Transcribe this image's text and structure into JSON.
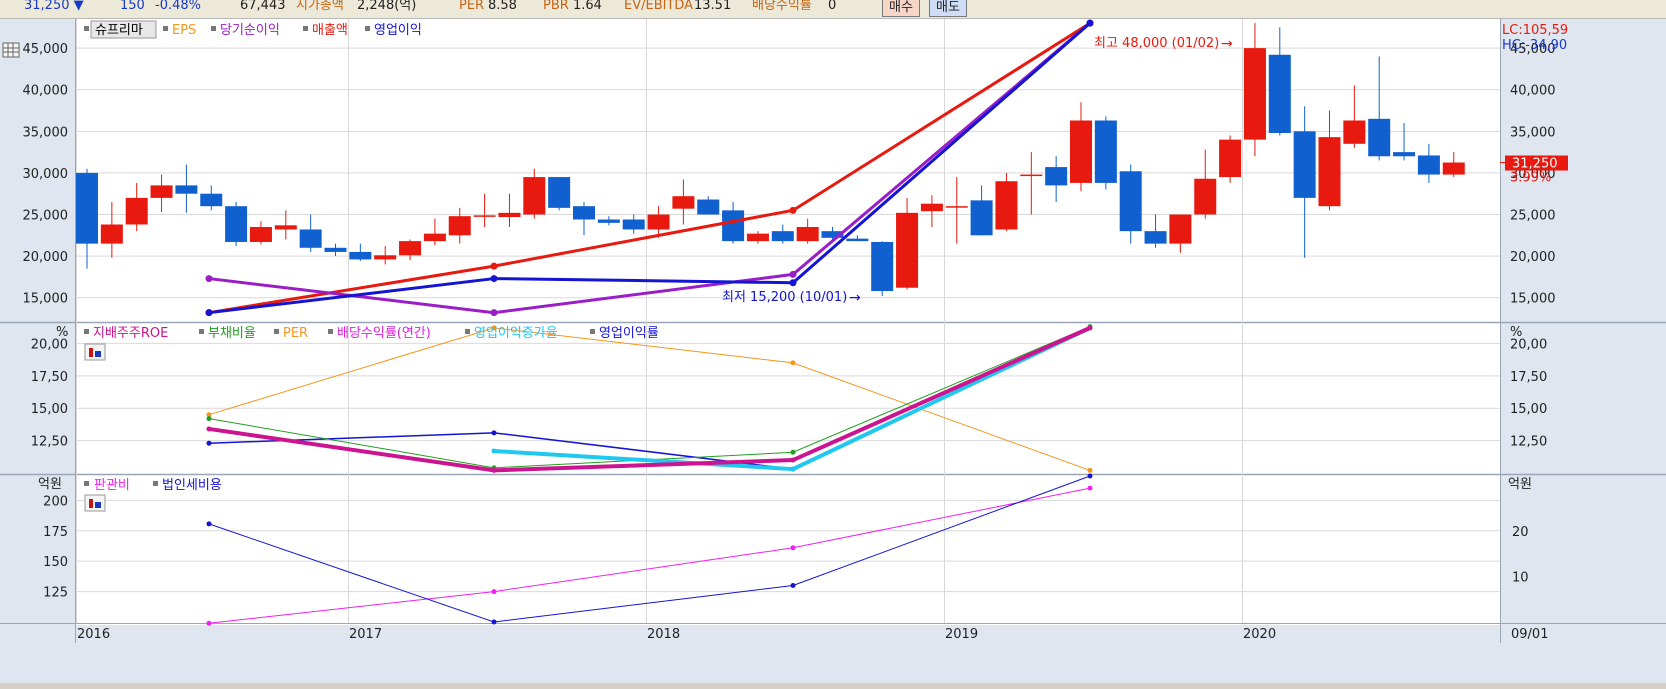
{
  "infobar": {
    "price": "31,250",
    "change": "150",
    "change_pct": "-0.48%",
    "volume": "67,443",
    "mktcap_label": "시가총액",
    "mktcap_value": "2,248(억)",
    "per_label": "PER",
    "per_value": "8.58",
    "pbr_label": "PBR",
    "pbr_value": "1.64",
    "ev_label": "EV/EBITDA",
    "ev_value": "13.51",
    "div_label": "배당수익률",
    "div_value": "0",
    "buy_label": "매수",
    "sell_label": "매도"
  },
  "colors": {
    "up": "#e8190e",
    "down": "#1160d0",
    "eps": "#f4961e",
    "netincome": "#9a1ec8",
    "sales": "#e8190e",
    "op_income": "#1414d2",
    "roe": "#cc1490",
    "debt": "#20a020",
    "per": "#f4961e",
    "div_yield": "#e020e0",
    "op_growth": "#20c8f0",
    "op_margin": "#1414d2",
    "sga": "#f020f0",
    "tax": "#1414d2"
  },
  "chart_data": [
    {
      "type": "candlestick",
      "title": "",
      "legend": [
        "슈프리마",
        "EPS",
        "당기순이익",
        "매출액",
        "영업이익"
      ],
      "x_labels": [
        "2016",
        "2017",
        "2018",
        "2019",
        "2020"
      ],
      "y_ticks": [
        15000,
        20000,
        25000,
        30000,
        35000,
        40000,
        45000
      ],
      "y_tick_labels": [
        "15,000",
        "20,000",
        "25,000",
        "30,000",
        "35,000",
        "40,000",
        "45,000"
      ],
      "ylim": [
        12200,
        48500
      ],
      "right_labels": {
        "lc": "LC:105,59",
        "hc": "HC:-34,90",
        "price": "31,250",
        "pct": "3.99%"
      },
      "last_price": 31250,
      "grid": true,
      "candles": [
        {
          "o": 30000,
          "h": 30500,
          "l": 18500,
          "c": 21500
        },
        {
          "o": 21500,
          "h": 26500,
          "l": 19800,
          "c": 23800
        },
        {
          "o": 23800,
          "h": 28800,
          "l": 23000,
          "c": 27000
        },
        {
          "o": 27000,
          "h": 29800,
          "l": 25300,
          "c": 28500
        },
        {
          "o": 28500,
          "h": 31000,
          "l": 25200,
          "c": 27500
        },
        {
          "o": 27500,
          "h": 28500,
          "l": 25500,
          "c": 26000
        },
        {
          "o": 26000,
          "h": 26500,
          "l": 21200,
          "c": 21700
        },
        {
          "o": 21700,
          "h": 24200,
          "l": 21400,
          "c": 23500
        },
        {
          "o": 23200,
          "h": 25500,
          "l": 22000,
          "c": 23700
        },
        {
          "o": 23200,
          "h": 25000,
          "l": 20500,
          "c": 21000
        },
        {
          "o": 21000,
          "h": 21500,
          "l": 20000,
          "c": 20500
        },
        {
          "o": 20500,
          "h": 21500,
          "l": 19400,
          "c": 19600
        },
        {
          "o": 19600,
          "h": 21200,
          "l": 19000,
          "c": 20100
        },
        {
          "o": 20100,
          "h": 22000,
          "l": 19500,
          "c": 21800
        },
        {
          "o": 21800,
          "h": 24500,
          "l": 21300,
          "c": 22700
        },
        {
          "o": 22500,
          "h": 25800,
          "l": 21500,
          "c": 24800
        },
        {
          "o": 24800,
          "h": 27500,
          "l": 23500,
          "c": 24900
        },
        {
          "o": 24700,
          "h": 27500,
          "l": 23500,
          "c": 25200
        },
        {
          "o": 25000,
          "h": 30500,
          "l": 24500,
          "c": 29500
        },
        {
          "o": 29500,
          "h": 29500,
          "l": 25500,
          "c": 25800
        },
        {
          "o": 26000,
          "h": 26500,
          "l": 22500,
          "c": 24400
        },
        {
          "o": 24400,
          "h": 24800,
          "l": 23700,
          "c": 24000
        },
        {
          "o": 24400,
          "h": 25000,
          "l": 22700,
          "c": 23200
        },
        {
          "o": 23200,
          "h": 26000,
          "l": 22200,
          "c": 25000
        },
        {
          "o": 25700,
          "h": 29200,
          "l": 23800,
          "c": 27200
        },
        {
          "o": 26800,
          "h": 27200,
          "l": 25000,
          "c": 25000
        },
        {
          "o": 25500,
          "h": 26500,
          "l": 21500,
          "c": 21800
        },
        {
          "o": 21800,
          "h": 23000,
          "l": 21500,
          "c": 22700
        },
        {
          "o": 23000,
          "h": 23800,
          "l": 21500,
          "c": 21800
        },
        {
          "o": 21800,
          "h": 24500,
          "l": 21500,
          "c": 23500
        },
        {
          "o": 23000,
          "h": 23500,
          "l": 21800,
          "c": 22200
        },
        {
          "o": 22100,
          "h": 22500,
          "l": 21800,
          "c": 21800
        },
        {
          "o": 21700,
          "h": 21800,
          "l": 15200,
          "c": 15800
        },
        {
          "o": 16200,
          "h": 27000,
          "l": 16000,
          "c": 25200
        },
        {
          "o": 25400,
          "h": 27300,
          "l": 23500,
          "c": 26300
        },
        {
          "o": 25900,
          "h": 29500,
          "l": 21500,
          "c": 26000
        },
        {
          "o": 26700,
          "h": 28500,
          "l": 22500,
          "c": 22500
        },
        {
          "o": 23200,
          "h": 30000,
          "l": 23000,
          "c": 29000
        },
        {
          "o": 29700,
          "h": 32500,
          "l": 25000,
          "c": 29800
        },
        {
          "o": 30700,
          "h": 32000,
          "l": 26500,
          "c": 28500
        },
        {
          "o": 28800,
          "h": 38500,
          "l": 27800,
          "c": 36300
        },
        {
          "o": 36300,
          "h": 36800,
          "l": 28000,
          "c": 28800
        },
        {
          "o": 30200,
          "h": 31000,
          "l": 21500,
          "c": 23000
        },
        {
          "o": 23000,
          "h": 25000,
          "l": 21000,
          "c": 21500
        },
        {
          "o": 21500,
          "h": 25000,
          "l": 20400,
          "c": 25000
        },
        {
          "o": 25000,
          "h": 32800,
          "l": 24500,
          "c": 29300
        },
        {
          "o": 29500,
          "h": 34500,
          "l": 28800,
          "c": 34000
        },
        {
          "o": 34000,
          "h": 48000,
          "l": 32000,
          "c": 45000
        },
        {
          "o": 44200,
          "h": 47500,
          "l": 34500,
          "c": 34800
        },
        {
          "o": 35000,
          "h": 38000,
          "l": 19800,
          "c": 27000
        },
        {
          "o": 26000,
          "h": 37500,
          "l": 25500,
          "c": 34300
        },
        {
          "o": 33500,
          "h": 40500,
          "l": 33000,
          "c": 36300
        },
        {
          "o": 36500,
          "h": 44000,
          "l": 31500,
          "c": 32000
        },
        {
          "o": 32500,
          "h": 36000,
          "l": 31500,
          "c": 32000
        },
        {
          "o": 32100,
          "h": 33500,
          "l": 28800,
          "c": 29800
        },
        {
          "o": 29800,
          "h": 32500,
          "l": 29500,
          "c": 31250
        }
      ],
      "overlays": [
        {
          "name": "매출액",
          "points": [
            [
              0,
              13200
            ],
            [
              1,
              18800
            ],
            [
              2,
              25500
            ],
            [
              3,
              48000
            ]
          ]
        },
        {
          "name": "당기순이익",
          "points": [
            [
              0,
              17300
            ],
            [
              1,
              13200
            ],
            [
              2,
              17800
            ],
            [
              3,
              48000
            ]
          ]
        },
        {
          "name": "영업이익",
          "points": [
            [
              0,
              13200
            ],
            [
              1,
              17300
            ],
            [
              2,
              16800
            ],
            [
              3,
              48000
            ]
          ]
        }
      ],
      "annotations": {
        "high": "최고 48,000 (01/02)",
        "low": "최저 15,200 (10/01)"
      }
    },
    {
      "type": "line",
      "title": "",
      "unit": "%",
      "legend": [
        "지배주주ROE",
        "부채비율",
        "PER",
        "배당수익률(연간)",
        "영업이익증가율",
        "영업이익률"
      ],
      "y_ticks": [
        12.5,
        15,
        17.5,
        20
      ],
      "y_tick_labels": [
        "12,50",
        "15,00",
        "17,50",
        "20,00"
      ],
      "ylim": [
        10.0,
        21.5
      ],
      "grid": true,
      "series": [
        {
          "name": "PER",
          "x": [
            0,
            1,
            2,
            3
          ],
          "y": [
            14.5,
            21.2,
            18.5,
            10.2
          ]
        },
        {
          "name": "영업이익률",
          "x": [
            0,
            1,
            2,
            3
          ],
          "y": [
            12.3,
            13.1,
            10.3,
            21.2
          ]
        },
        {
          "name": "부채비율",
          "x": [
            0,
            1,
            2,
            3
          ],
          "y": [
            14.2,
            10.4,
            11.6,
            21.3
          ]
        },
        {
          "name": "영업이익증가율",
          "x": [
            1,
            2,
            3
          ],
          "y": [
            11.7,
            10.3,
            21.2
          ]
        },
        {
          "name": "지배주주ROE",
          "x": [
            0,
            1,
            2,
            3
          ],
          "y": [
            13.4,
            10.2,
            11.0,
            21.2
          ]
        }
      ]
    },
    {
      "type": "line",
      "title": "",
      "unit": "억원",
      "legend": [
        "판관비",
        "법인세비용"
      ],
      "y_ticks": [
        125,
        150,
        175,
        200
      ],
      "y_tick_labels": [
        "125",
        "150",
        "175",
        "200"
      ],
      "ylim": [
        100,
        220
      ],
      "y2_ticks": [
        10,
        20
      ],
      "y2_tick_labels": [
        "10",
        "20"
      ],
      "y2lim": [
        0,
        32
      ],
      "grid": true,
      "series": [
        {
          "name": "판관비",
          "axis": "left",
          "x": [
            0,
            1,
            2,
            3
          ],
          "y": [
            99,
            125,
            161,
            210
          ]
        },
        {
          "name": "법인세비용",
          "axis": "right",
          "x": [
            0,
            1,
            2,
            3
          ],
          "y": [
            21.5,
            0,
            8,
            32
          ]
        }
      ],
      "date_label": "09/01"
    }
  ]
}
